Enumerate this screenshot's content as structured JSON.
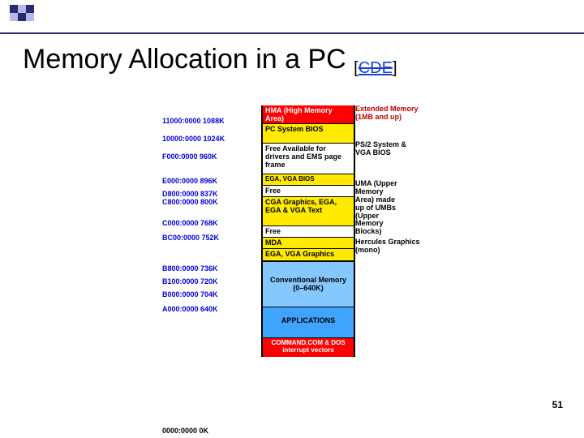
{
  "slide": {
    "title_main": "Memory Allocation in a PC ",
    "title_suffix_open": "[",
    "title_suffix_link": "CDE",
    "title_suffix_close": "]",
    "page_number": "51"
  },
  "addresses": {
    "a0": "11000:0000 1088K",
    "a1": "10000:0000 1024K",
    "a2": "F000:0000 960K",
    "a3": "E000:0000 896K",
    "a4a": "D800:0000 837K",
    "a4b": "C800:0000 800K",
    "a5": "C000:0000 768K",
    "a6": "BC00:0000 752K",
    "a7": "B800:0000 736K",
    "a8": "B100:0000 720K",
    "a9": "B000:0000 704K",
    "a10": "A000:0000 640K",
    "a11": "0000:0000 0K"
  },
  "segments": {
    "s0": "HMA (High Memory Area)",
    "s1a": "PC System BIOS",
    "s2": "Free Available for drivers and EMS page frame",
    "s3": "EGA, VGA BIOS",
    "s4": "Free",
    "s5": "CGA Graphics, EGA, EGA & VGA Text",
    "s6": "Free",
    "s7": "MDA",
    "s8": "EGA, VGA Graphics",
    "s9": "Conventional Memory (0–640K)",
    "s10": "APPLICATIONS",
    "s11": "COMMAND.COM & DOS interrupt vectors"
  },
  "right": {
    "r0": "Extended Memory (1MB and up)",
    "r1": "PS/2 System & VGA BIOS",
    "r2": "UMA (Upper Memory Area) made up of UMBs (Upper Memory Blocks)",
    "r3": "Hercules Graphics (mono)"
  }
}
